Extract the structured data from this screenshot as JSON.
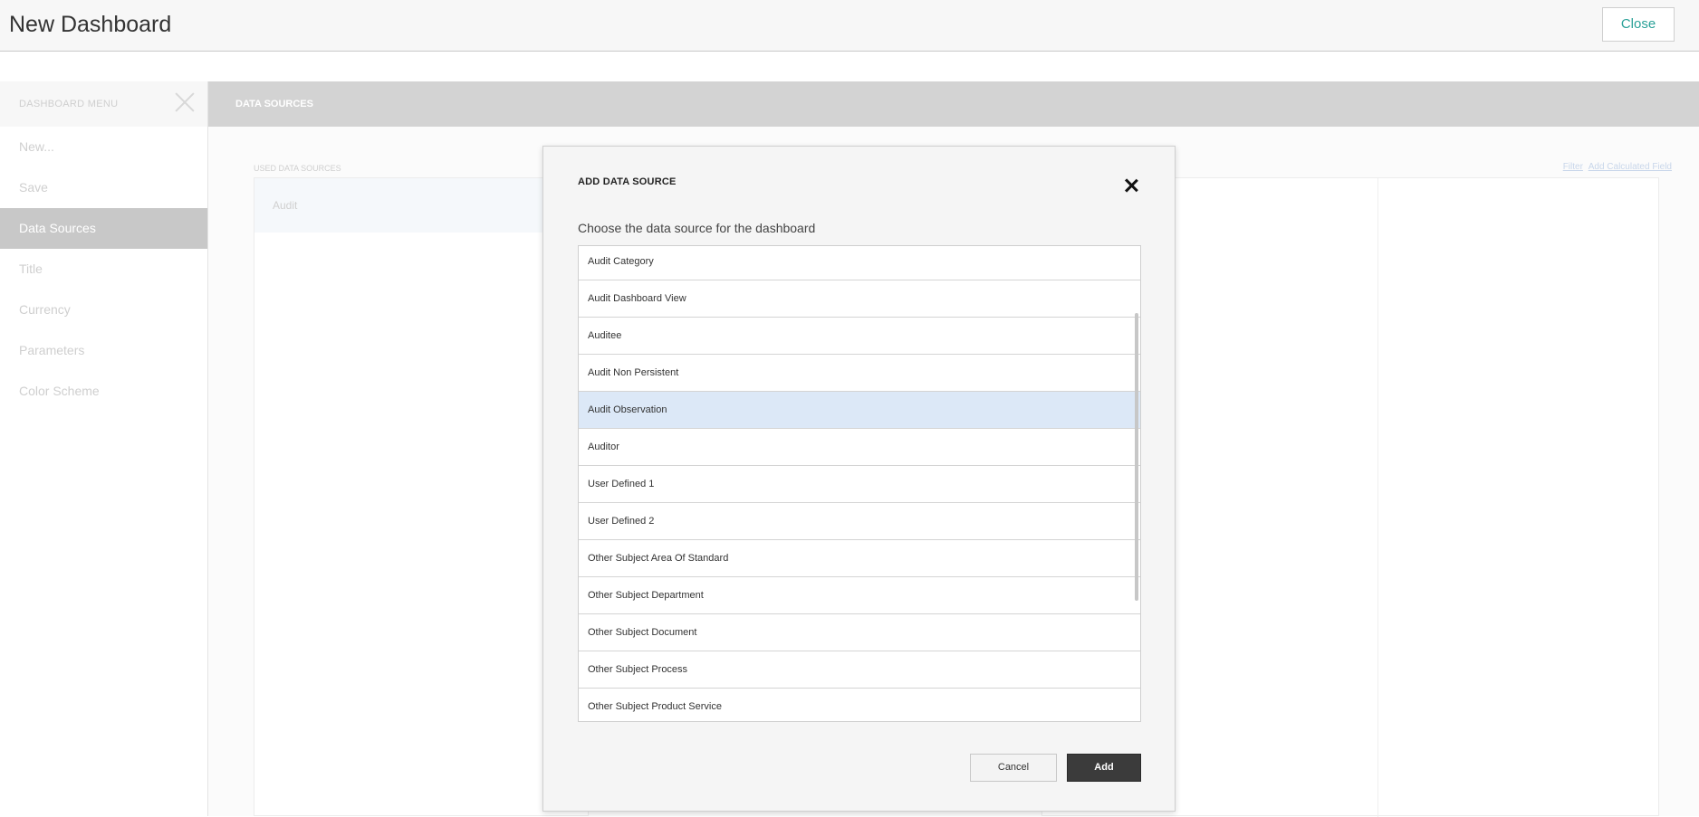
{
  "header": {
    "title": "New Dashboard",
    "close_label": "Close"
  },
  "sidebar": {
    "menu_title": "DASHBOARD MENU",
    "items": [
      {
        "label": "New..."
      },
      {
        "label": "Save"
      },
      {
        "label": "Data Sources",
        "active": true
      },
      {
        "label": "Title"
      },
      {
        "label": "Currency"
      },
      {
        "label": "Parameters"
      },
      {
        "label": "Color Scheme"
      }
    ]
  },
  "main": {
    "section_title": "DATA SOURCES",
    "used_label": "USED DATA SOURCES",
    "used_items": [
      "Audit"
    ],
    "links": [
      "Filter",
      "Add Calculated Field"
    ]
  },
  "modal": {
    "title": "ADD DATA SOURCE",
    "subtitle": "Choose the data source for the dashboard",
    "items": [
      "Audit Category",
      "Audit Dashboard View",
      "Auditee",
      "Audit Non Persistent",
      "Audit Observation",
      "Auditor",
      "User Defined 1",
      "User Defined 2",
      "Other Subject Area Of Standard",
      "Other Subject Department",
      "Other Subject Document",
      "Other Subject Process",
      "Other Subject Product Service"
    ],
    "selected_item": "Audit Observation",
    "cancel_label": "Cancel",
    "add_label": "Add"
  }
}
